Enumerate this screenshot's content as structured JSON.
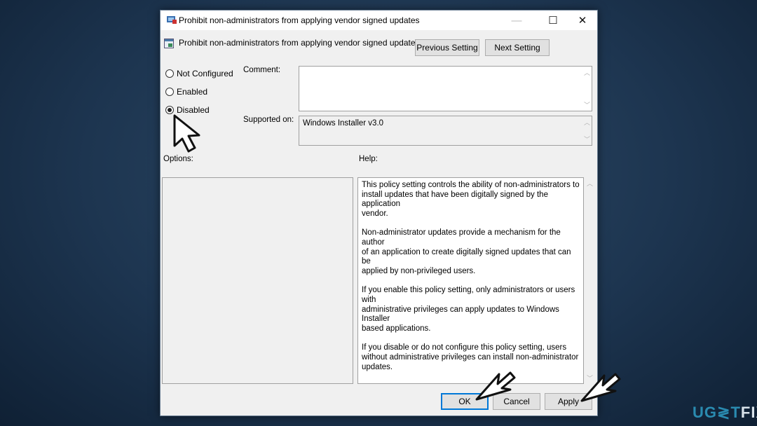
{
  "window": {
    "title": "Prohibit non-administrators from applying vendor signed updates",
    "minimize": "—",
    "maximize": "☐",
    "close": "✕"
  },
  "header": {
    "setting_name": "Prohibit non-administrators from applying vendor signed updates",
    "previous_button": "Previous Setting",
    "next_button": "Next Setting"
  },
  "state": {
    "options": [
      {
        "label": "Not Configured",
        "selected": false
      },
      {
        "label": "Enabled",
        "selected": false
      },
      {
        "label": "Disabled",
        "selected": true
      }
    ]
  },
  "comment": {
    "label": "Comment:",
    "value": ""
  },
  "supported": {
    "label": "Supported on:",
    "value": "Windows Installer v3.0"
  },
  "options_label": "Options:",
  "help_label": "Help:",
  "help": [
    [
      "This policy setting controls the ability of non-administrators to",
      "install updates that have been digitally signed by the application",
      "vendor."
    ],
    [
      "Non-administrator updates provide a mechanism for the author",
      "of an application to create digitally signed updates that can be",
      "applied by non-privileged users."
    ],
    [
      "If you enable this policy setting, only administrators or users with",
      "administrative privileges can apply updates to Windows Installer",
      "based applications."
    ],
    [
      "If you disable or do not configure this policy setting, users",
      "without administrative privileges can install non-administrator",
      "updates."
    ]
  ],
  "footer": {
    "ok": "OK",
    "cancel": "Cancel",
    "apply": "Apply"
  },
  "watermark": {
    "text_a": "UG",
    "text_b": "≷",
    "text_c": "T",
    "text_d": "FIX"
  },
  "colors": {
    "accent": "#0078d7",
    "watermark": "#2a8bb0"
  }
}
